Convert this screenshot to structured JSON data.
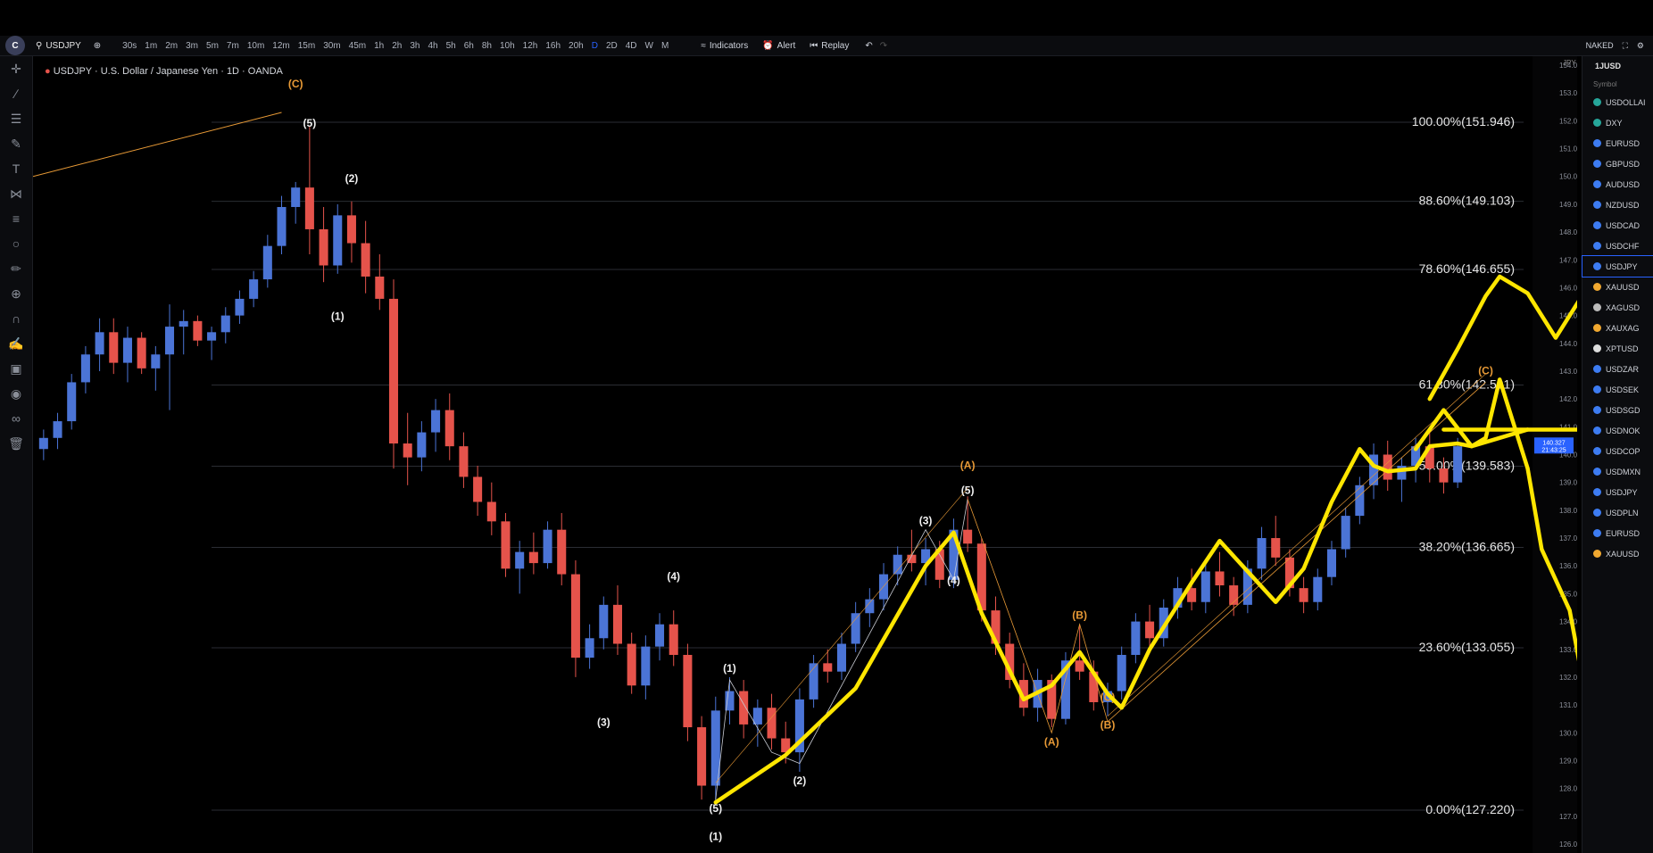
{
  "toolbar": {
    "logo": "C",
    "symbol": "USDJPY",
    "timeframes": [
      "30s",
      "1m",
      "2m",
      "3m",
      "5m",
      "7m",
      "10m",
      "12m",
      "15m",
      "30m",
      "45m",
      "1h",
      "2h",
      "3h",
      "4h",
      "5h",
      "6h",
      "8h",
      "10h",
      "12h",
      "16h",
      "20h",
      "D",
      "2D",
      "4D",
      "W",
      "M"
    ],
    "active_timeframe": "D",
    "indicators_label": "Indicators",
    "alert_label": "Alert",
    "replay_label": "Replay",
    "layout_label": "NAKED"
  },
  "chart_title": "USDJPY · U.S. Dollar / Japanese Yen · 1D · OANDA",
  "price_axis": {
    "label": "JPY",
    "ticks": [
      "154.000",
      "153.000",
      "152.000",
      "151.000",
      "150.000",
      "149.000",
      "148.000",
      "147.000",
      "146.000",
      "145.000",
      "144.000",
      "143.000",
      "142.000",
      "141.000",
      "140.000",
      "139.000",
      "138.000",
      "137.000",
      "136.000",
      "135.000",
      "134.000",
      "133.000",
      "132.000",
      "131.000",
      "130.000",
      "129.000",
      "128.000",
      "127.000",
      "126.000"
    ],
    "current_price": "140.327",
    "current_time": "21:43:25"
  },
  "fib_levels": [
    {
      "label": "100.00%(151.946)",
      "price": 151.946
    },
    {
      "label": "88.60%(149.103)",
      "price": 149.103
    },
    {
      "label": "78.60%(146.655)",
      "price": 146.655
    },
    {
      "label": "61.80%(142.501)",
      "price": 142.501
    },
    {
      "label": "50.00%(139.583)",
      "price": 139.583
    },
    {
      "label": "38.20%(136.665)",
      "price": 136.665
    },
    {
      "label": "23.60%(133.055)",
      "price": 133.055
    },
    {
      "label": "0.00%(127.220)",
      "price": 127.22
    }
  ],
  "wave_labels": [
    {
      "text": "(C)",
      "color": "orange",
      "bar": 18,
      "price": 153.0,
      "pos": "above"
    },
    {
      "text": "(5)",
      "color": "white",
      "bar": 19,
      "price": 151.6,
      "pos": "above"
    },
    {
      "text": "(2)",
      "color": "white",
      "bar": 22,
      "price": 149.6,
      "pos": "above"
    },
    {
      "text": "(1)",
      "color": "white",
      "bar": 21,
      "price": 145.3,
      "pos": "below"
    },
    {
      "text": "(4)",
      "color": "white",
      "bar": 45,
      "price": 135.3,
      "pos": "above"
    },
    {
      "text": "(3)",
      "color": "white",
      "bar": 40,
      "price": 130.7,
      "pos": "below"
    },
    {
      "text": "(5)",
      "color": "white",
      "bar": 48,
      "price": 127.6,
      "pos": "below"
    },
    {
      "text": "(1)",
      "color": "white",
      "bar": 48,
      "price": 126.6,
      "pos": "below"
    },
    {
      "text": "(1)",
      "color": "white",
      "bar": 49,
      "price": 132.0,
      "pos": "above"
    },
    {
      "text": "(2)",
      "color": "white",
      "bar": 54,
      "price": 128.6,
      "pos": "below"
    },
    {
      "text": "(3)",
      "color": "white",
      "bar": 63,
      "price": 137.3,
      "pos": "above"
    },
    {
      "text": "(4)",
      "color": "white",
      "bar": 65,
      "price": 135.8,
      "pos": "below"
    },
    {
      "text": "(5)",
      "color": "white",
      "bar": 66,
      "price": 138.4,
      "pos": "above"
    },
    {
      "text": "(A)",
      "color": "orange",
      "bar": 66,
      "price": 139.3,
      "pos": "above"
    },
    {
      "text": "(A)",
      "color": "orange",
      "bar": 72,
      "price": 130.0,
      "pos": "below"
    },
    {
      "text": "(B)",
      "color": "orange",
      "bar": 74,
      "price": 133.9,
      "pos": "above"
    },
    {
      "text": "(C)",
      "color": "orange",
      "bar": 76,
      "price": 131.6,
      "pos": "below"
    },
    {
      "text": "(B)",
      "color": "orange",
      "bar": 76,
      "price": 130.6,
      "pos": "below"
    },
    {
      "text": "(C)",
      "color": "orange",
      "bar": 103,
      "price": 142.7,
      "pos": "above"
    }
  ],
  "watchlist": {
    "title": "1JUSD",
    "symbol_header": "Symbol",
    "selected": "USDJPY",
    "items": [
      {
        "name": "USDOLLAI",
        "color": "#26a69a"
      },
      {
        "name": "DXY",
        "color": "#26a69a"
      },
      {
        "name": "EURUSD",
        "color": "#3d7cf2"
      },
      {
        "name": "GBPUSD",
        "color": "#3d7cf2"
      },
      {
        "name": "AUDUSD",
        "color": "#3d7cf2"
      },
      {
        "name": "NZDUSD",
        "color": "#3d7cf2"
      },
      {
        "name": "USDCAD",
        "color": "#3d7cf2"
      },
      {
        "name": "USDCHF",
        "color": "#3d7cf2"
      },
      {
        "name": "USDJPY",
        "color": "#3d7cf2"
      },
      {
        "name": "XAUUSD",
        "color": "#f0a830"
      },
      {
        "name": "XAGUSD",
        "color": "#bbbbbb"
      },
      {
        "name": "XAUXAG",
        "color": "#f0a830"
      },
      {
        "name": "XPTUSD",
        "color": "#dddddd"
      },
      {
        "name": "USDZAR",
        "color": "#3d7cf2"
      },
      {
        "name": "USDSEK",
        "color": "#3d7cf2"
      },
      {
        "name": "USDSGD",
        "color": "#3d7cf2"
      },
      {
        "name": "USDNOK",
        "color": "#3d7cf2"
      },
      {
        "name": "USDCOP",
        "color": "#3d7cf2"
      },
      {
        "name": "USDMXN",
        "color": "#3d7cf2"
      },
      {
        "name": "USDJPY",
        "color": "#3d7cf2"
      },
      {
        "name": "USDPLN",
        "color": "#3d7cf2"
      },
      {
        "name": "EURUSD",
        "color": "#3d7cf2"
      },
      {
        "name": "XAUUSD",
        "color": "#f0a830"
      }
    ]
  },
  "colors": {
    "up": "#4b74d6",
    "down": "#e5534b",
    "drawing": "#ffe600",
    "fib_line": "#2a2d33",
    "wave_orange": "#e89a36"
  },
  "chart_data": {
    "type": "candlestick",
    "ylim": [
      126,
      154
    ],
    "ohlc": [
      [
        140.2,
        140.9,
        139.8,
        140.6
      ],
      [
        140.6,
        141.5,
        140.2,
        141.2
      ],
      [
        141.2,
        142.9,
        140.9,
        142.6
      ],
      [
        142.6,
        143.9,
        142.2,
        143.6
      ],
      [
        143.6,
        144.9,
        143.0,
        144.4
      ],
      [
        144.4,
        144.9,
        142.9,
        143.3
      ],
      [
        143.3,
        144.6,
        142.6,
        144.2
      ],
      [
        144.2,
        144.4,
        142.9,
        143.1
      ],
      [
        143.1,
        143.9,
        142.3,
        143.6
      ],
      [
        143.6,
        145.4,
        141.6,
        144.6
      ],
      [
        144.6,
        145.2,
        143.6,
        144.8
      ],
      [
        144.8,
        145.0,
        143.9,
        144.1
      ],
      [
        144.1,
        144.6,
        143.4,
        144.4
      ],
      [
        144.4,
        145.3,
        144.0,
        145.0
      ],
      [
        145.0,
        145.9,
        144.7,
        145.6
      ],
      [
        145.6,
        146.6,
        145.3,
        146.3
      ],
      [
        146.3,
        147.9,
        146.0,
        147.5
      ],
      [
        147.5,
        149.3,
        147.2,
        148.9
      ],
      [
        148.9,
        149.8,
        148.3,
        149.6
      ],
      [
        149.6,
        151.8,
        147.2,
        148.1
      ],
      [
        148.1,
        148.9,
        146.2,
        146.8
      ],
      [
        146.8,
        149.0,
        146.5,
        148.6
      ],
      [
        148.6,
        149.1,
        146.9,
        147.6
      ],
      [
        147.6,
        148.4,
        145.8,
        146.4
      ],
      [
        146.4,
        147.2,
        145.2,
        145.6
      ],
      [
        145.6,
        146.3,
        139.5,
        140.4
      ],
      [
        140.4,
        141.5,
        138.9,
        139.9
      ],
      [
        139.9,
        141.2,
        139.4,
        140.8
      ],
      [
        140.8,
        142.0,
        140.1,
        141.6
      ],
      [
        141.6,
        142.2,
        139.8,
        140.3
      ],
      [
        140.3,
        140.8,
        138.8,
        139.2
      ],
      [
        139.2,
        139.6,
        137.8,
        138.3
      ],
      [
        138.3,
        139.0,
        137.1,
        137.6
      ],
      [
        137.6,
        137.9,
        135.6,
        135.9
      ],
      [
        135.9,
        136.9,
        135.0,
        136.5
      ],
      [
        136.5,
        137.2,
        135.7,
        136.1
      ],
      [
        136.1,
        137.6,
        135.9,
        137.3
      ],
      [
        137.3,
        137.9,
        135.3,
        135.7
      ],
      [
        135.7,
        136.2,
        132.0,
        132.7
      ],
      [
        132.7,
        133.9,
        132.3,
        133.4
      ],
      [
        133.4,
        134.9,
        133.0,
        134.6
      ],
      [
        134.6,
        135.3,
        132.8,
        133.2
      ],
      [
        133.2,
        133.6,
        131.4,
        131.7
      ],
      [
        131.7,
        133.5,
        131.2,
        133.1
      ],
      [
        133.1,
        134.3,
        132.6,
        133.9
      ],
      [
        133.9,
        134.4,
        132.4,
        132.8
      ],
      [
        132.8,
        133.2,
        129.7,
        130.2
      ],
      [
        130.2,
        130.6,
        127.6,
        128.1
      ],
      [
        128.1,
        131.3,
        127.5,
        130.8
      ],
      [
        130.8,
        132.0,
        130.3,
        131.5
      ],
      [
        131.5,
        131.9,
        129.8,
        130.3
      ],
      [
        130.3,
        131.2,
        129.5,
        130.9
      ],
      [
        130.9,
        131.4,
        129.4,
        129.8
      ],
      [
        129.8,
        130.4,
        128.9,
        129.3
      ],
      [
        129.3,
        131.6,
        128.6,
        131.2
      ],
      [
        131.2,
        132.8,
        130.9,
        132.5
      ],
      [
        132.5,
        133.0,
        131.8,
        132.2
      ],
      [
        132.2,
        133.6,
        131.9,
        133.2
      ],
      [
        133.2,
        134.7,
        132.9,
        134.3
      ],
      [
        134.3,
        135.2,
        133.8,
        134.8
      ],
      [
        134.8,
        136.1,
        134.4,
        135.7
      ],
      [
        135.7,
        136.7,
        135.3,
        136.4
      ],
      [
        136.4,
        137.3,
        135.8,
        136.1
      ],
      [
        136.1,
        137.0,
        135.3,
        136.6
      ],
      [
        136.6,
        136.9,
        135.2,
        135.5
      ],
      [
        135.5,
        137.7,
        135.2,
        137.3
      ],
      [
        137.3,
        138.5,
        136.5,
        136.8
      ],
      [
        136.8,
        137.0,
        134.0,
        134.4
      ],
      [
        134.4,
        134.9,
        132.8,
        133.2
      ],
      [
        133.2,
        133.6,
        131.6,
        131.9
      ],
      [
        131.9,
        132.5,
        130.6,
        130.9
      ],
      [
        130.9,
        132.3,
        130.4,
        131.9
      ],
      [
        131.9,
        132.1,
        130.2,
        130.5
      ],
      [
        130.5,
        132.9,
        130.3,
        132.6
      ],
      [
        132.6,
        133.9,
        131.9,
        132.2
      ],
      [
        132.2,
        132.6,
        130.8,
        131.1
      ],
      [
        131.1,
        131.8,
        130.6,
        131.5
      ],
      [
        131.5,
        133.1,
        131.2,
        132.8
      ],
      [
        132.8,
        134.3,
        132.5,
        134.0
      ],
      [
        134.0,
        134.6,
        132.9,
        133.4
      ],
      [
        133.4,
        134.8,
        133.1,
        134.5
      ],
      [
        134.5,
        135.6,
        134.1,
        135.2
      ],
      [
        135.2,
        135.9,
        134.4,
        134.7
      ],
      [
        134.7,
        136.1,
        134.3,
        135.8
      ],
      [
        135.8,
        136.5,
        134.9,
        135.3
      ],
      [
        135.3,
        135.6,
        134.2,
        134.6
      ],
      [
        134.6,
        136.2,
        134.3,
        135.9
      ],
      [
        135.9,
        137.4,
        135.5,
        137.0
      ],
      [
        137.0,
        137.8,
        136.0,
        136.3
      ],
      [
        136.3,
        136.6,
        134.9,
        135.2
      ],
      [
        135.2,
        135.6,
        134.3,
        134.7
      ],
      [
        134.7,
        135.9,
        134.4,
        135.6
      ],
      [
        135.6,
        136.9,
        135.3,
        136.6
      ],
      [
        136.6,
        138.1,
        136.3,
        137.8
      ],
      [
        137.8,
        139.2,
        137.5,
        138.9
      ],
      [
        138.9,
        140.4,
        138.4,
        140.0
      ],
      [
        140.0,
        140.5,
        138.7,
        139.1
      ],
      [
        139.1,
        139.9,
        138.3,
        139.6
      ],
      [
        139.6,
        140.6,
        139.0,
        140.3
      ],
      [
        140.3,
        140.8,
        139.0,
        139.5
      ],
      [
        139.5,
        139.9,
        138.6,
        139.0
      ],
      [
        139.0,
        140.6,
        138.8,
        140.3
      ]
    ]
  }
}
